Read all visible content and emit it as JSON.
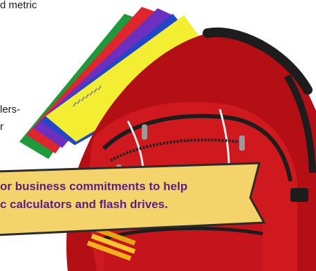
{
  "body_text_fragments": [
    "d metric",
    "lers-",
    "r"
  ],
  "banner": {
    "line1": "or business commitments to help",
    "line2": "c calculators and flash drives."
  },
  "colors": {
    "banner_fill": "#f4d46a",
    "banner_border": "#2b2b2b",
    "banner_text": "#5b1e82",
    "backpack_red": "#c8141b",
    "backpack_dark": "#1d1d1d",
    "folder_yellow": "#f3ee32",
    "folder_blue": "#2146c8",
    "folder_purple": "#6c2fc0",
    "folder_red": "#e0262d",
    "folder_green": "#1f9a3a"
  },
  "image": {
    "subject": "red-backpack-with-folders-and-pencils"
  }
}
